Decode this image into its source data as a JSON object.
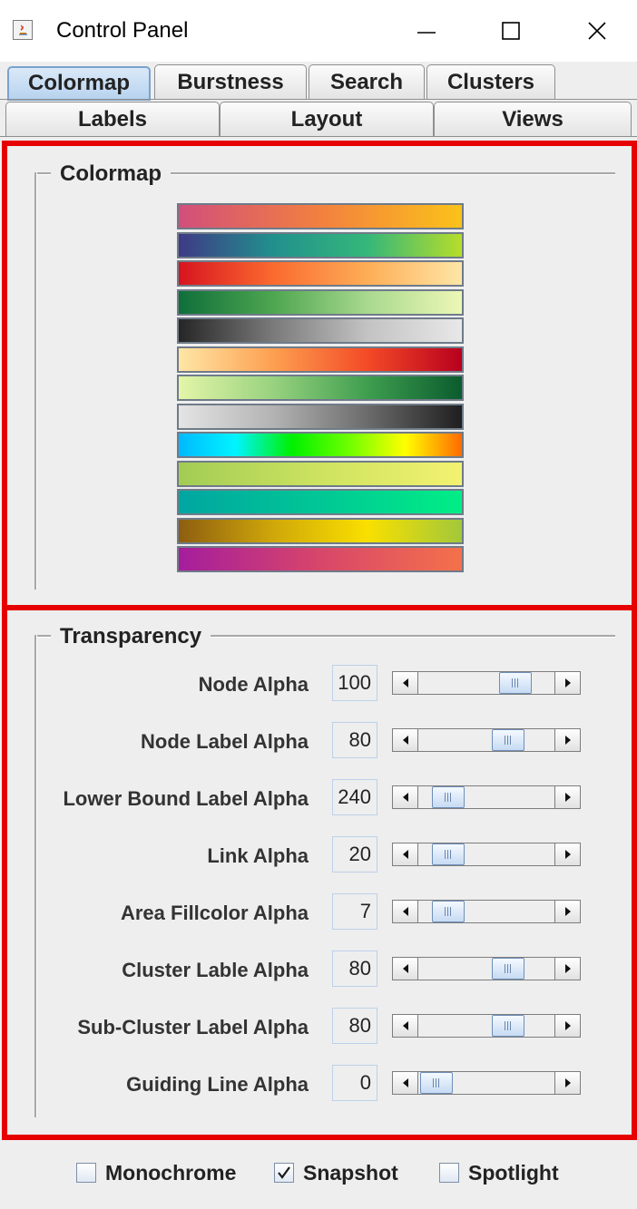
{
  "window": {
    "title": "Control Panel"
  },
  "tabs": {
    "row1": [
      {
        "label": "Colormap",
        "selected": true
      },
      {
        "label": "Burstness",
        "selected": false
      },
      {
        "label": "Search",
        "selected": false
      },
      {
        "label": "Clusters",
        "selected": false
      }
    ],
    "row2": [
      {
        "label": "Labels"
      },
      {
        "label": "Layout"
      },
      {
        "label": "Views"
      }
    ]
  },
  "colormap": {
    "title": "Colormap",
    "swatches": [
      {
        "name": "pink-orange-yellow",
        "stops": [
          "#d14f7b",
          "#f2803f",
          "#fbc21a"
        ]
      },
      {
        "name": "viridis",
        "stops": [
          "#3f3a86",
          "#21908d",
          "#35b77a",
          "#b6dd2a"
        ]
      },
      {
        "name": "red-yellow",
        "stops": [
          "#d7141f",
          "#fb6a2f",
          "#fdae57",
          "#fee6a6"
        ]
      },
      {
        "name": "green-lightgreen",
        "stops": [
          "#0f6f3a",
          "#4ea650",
          "#a9d98e",
          "#edf7b6"
        ]
      },
      {
        "name": "black-gray",
        "stops": [
          "#262626",
          "#7a7a7a",
          "#c3c3c3",
          "#e8e8e8"
        ]
      },
      {
        "name": "yellow-red",
        "stops": [
          "#fee6a6",
          "#fda050",
          "#f44a27",
          "#b8001e"
        ]
      },
      {
        "name": "lightgreen-green",
        "stops": [
          "#e4f5a8",
          "#98d27f",
          "#3e9e4f",
          "#0b5c2e"
        ]
      },
      {
        "name": "gray-black",
        "stops": [
          "#e4e4e4",
          "#b3b3b3",
          "#6b6b6b",
          "#1f1f1f"
        ]
      },
      {
        "name": "cyan-green-yellow-orange",
        "stops": [
          "#00b9ff",
          "#00f4ff",
          "#00f000",
          "#6dff00",
          "#ffff00",
          "#ff6a00"
        ]
      },
      {
        "name": "olive-yellow",
        "stops": [
          "#a2cc55",
          "#cde360",
          "#f3f270"
        ]
      },
      {
        "name": "teal-green",
        "stops": [
          "#00a6a0",
          "#00c795",
          "#00ee86"
        ]
      },
      {
        "name": "brown-yellow-green",
        "stops": [
          "#8d5e10",
          "#d0a70a",
          "#f9e000",
          "#a2c83a"
        ]
      },
      {
        "name": "purple-orange",
        "stops": [
          "#a51d9c",
          "#d8466a",
          "#f4714a"
        ]
      }
    ]
  },
  "transparency": {
    "title": "Transparency",
    "rows": [
      {
        "label": "Node Alpha",
        "value": "100",
        "fraction": 0.78
      },
      {
        "label": "Node Label Alpha",
        "value": "80",
        "fraction": 0.71
      },
      {
        "label": "Lower Bound Label Alpha",
        "value": "240",
        "fraction": 0.13
      },
      {
        "label": "Link Alpha",
        "value": "20",
        "fraction": 0.13
      },
      {
        "label": "Area Fillcolor Alpha",
        "value": "7",
        "fraction": 0.13
      },
      {
        "label": "Cluster Lable Alpha",
        "value": "80",
        "fraction": 0.71
      },
      {
        "label": "Sub-Cluster Label Alpha",
        "value": "80",
        "fraction": 0.71
      },
      {
        "label": "Guiding Line Alpha",
        "value": "0",
        "fraction": 0.02
      }
    ]
  },
  "options": [
    {
      "label": "Monochrome",
      "checked": false
    },
    {
      "label": "Snapshot",
      "checked": true
    },
    {
      "label": "Spotlight",
      "checked": false
    }
  ]
}
